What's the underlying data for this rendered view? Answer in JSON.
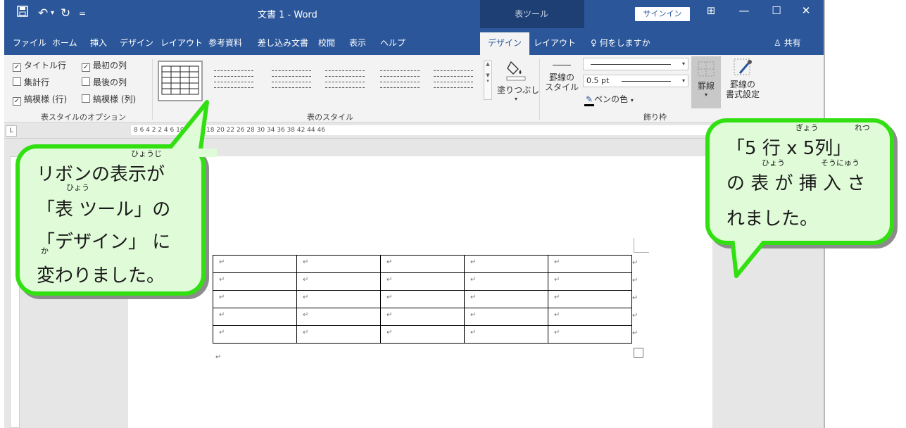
{
  "titlebar": {
    "save_icon": "save-icon",
    "undo_glyph": "↶",
    "undo_menu": "▾",
    "redo_glyph": "↻",
    "customize_glyph": "=",
    "doc_title": "文書 1  -  Word",
    "context_title": "表ツール",
    "signin_label": "サインイン",
    "display_options_glyph": "⊞",
    "minimize_glyph": "—",
    "maximize_glyph": "☐",
    "close_glyph": "✕"
  },
  "tabs": {
    "items": [
      "ファイル",
      "ホーム",
      "挿入",
      "デザイン",
      "レイアウト",
      "参考資料",
      "差し込み文書",
      "校閲",
      "表示",
      "ヘルプ"
    ],
    "context_items": [
      "デザイン",
      "レイアウト"
    ],
    "active": "デザイン",
    "tellme": "何をしますか",
    "share": "共有"
  },
  "ribbon": {
    "style_options": {
      "items": [
        {
          "label": "タイトル行",
          "checked": true
        },
        {
          "label": "集計行",
          "checked": false
        },
        {
          "label": "縞模様 (行)",
          "checked": true
        },
        {
          "label": "最初の列",
          "checked": true
        },
        {
          "label": "最後の列",
          "checked": false
        },
        {
          "label": "縞模様 (列)",
          "checked": false
        }
      ],
      "group_label": "表スタイルのオプション"
    },
    "table_styles": {
      "group_label": "表のスタイル",
      "shading_label": "塗りつぶし"
    },
    "borders": {
      "border_styles_label1": "罫線の",
      "border_styles_label2": "スタイル",
      "line_weight": "0.5 pt",
      "pen_color_label": "ペンの色",
      "borders_label": "罫線",
      "border_painter_label1": "罫線の",
      "border_painter_label2": "書式設定",
      "group_label": "飾り枠"
    }
  },
  "ruler": {
    "tab_selector": "L",
    "marks": "8    6    4    2           2    4    6         10   12   14        18   20   22        26   28   30        34   36   38        42   44   46"
  },
  "document": {
    "table_rows": [
      [
        "↵",
        "↵",
        "↵",
        "↵",
        "↵"
      ],
      [
        "↵",
        "↵",
        "↵",
        "↵",
        "↵"
      ],
      [
        "↵",
        "↵",
        "↵",
        "↵",
        "↵"
      ],
      [
        "↵",
        "↵",
        "↵",
        "↵",
        "↵"
      ],
      [
        "↵",
        "↵",
        "↵",
        "↵",
        "↵"
      ]
    ],
    "row_end_mark": "↵",
    "para_mark": "↵"
  },
  "callout_left": {
    "line1": "リボンの表示が",
    "line2": "「表 ツール」の",
    "line3": "「デザイン」 に",
    "line4": "変わりました。",
    "ruby_hyouji": "ひょうじ",
    "ruby_hyou": "ひょう",
    "ruby_ka": "か"
  },
  "callout_right": {
    "line1": "「5 行 x 5列」",
    "line2": "の 表 が 挿 入 さ",
    "line3": "れました。",
    "ruby_gyou": "ぎょう",
    "ruby_retsu": "れつ",
    "ruby_hyou": "ひょう",
    "ruby_sounyuu": "そうにゅう"
  }
}
